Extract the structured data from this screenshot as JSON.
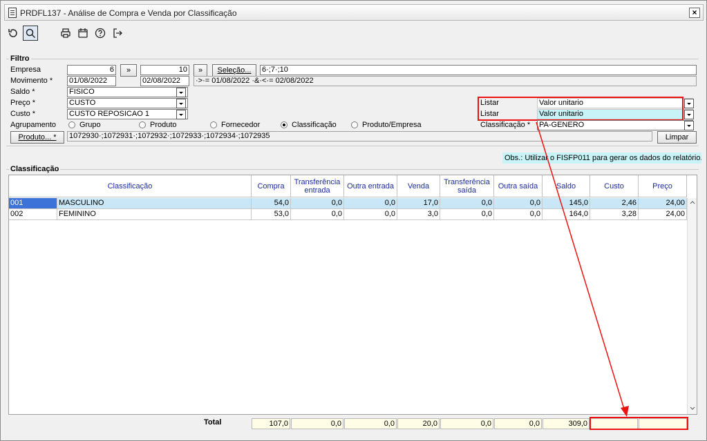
{
  "window": {
    "title": "PRDFL137 - Análise de Compra e Venda por Classificação",
    "close": "×"
  },
  "filtro": {
    "legend": "Filtro",
    "empresa_label": "Empresa",
    "empresa_from": "6",
    "empresa_to": "10",
    "range_btn": "»",
    "selecao_btn": "Seleção...",
    "selecao_value": "6·;7·;10",
    "movimento_label": "Movimento *",
    "movimento_from": "01/08/2022",
    "movimento_to": "02/08/2022",
    "movimento_expr": "·>·= 01/08/2022 ·&·<·= 02/08/2022",
    "saldo_label": "Saldo *",
    "saldo_value": "FISICO",
    "preco_label": "Preço *",
    "preco_value": "CUSTO",
    "custo_label": "Custo *",
    "custo_value": "CUSTO REPOSICAO 1",
    "agrupamento_label": "Agrupamento",
    "agrupamento_options": [
      "Grupo",
      "Produto",
      "Fornecedor",
      "Classificação",
      "Produto/Empresa"
    ],
    "agrupamento_selected": "Classificação",
    "produto_btn": "Produto... *",
    "produto_value": "1072930·;1072931·;1072932·;1072933·;1072934·;1072935",
    "listar1_label": "Listar",
    "listar1_value": "Valor unitario",
    "listar2_label": "Listar",
    "listar2_value": "Valor unitario",
    "classificacao_label": "Classificação *",
    "classificacao_value": "PA-GENERO",
    "limpar_btn": "Limpar"
  },
  "obs": "Obs.: Utilizar o FISFP011 para gerar os dados do relatório.",
  "grid": {
    "legend": "Classificação",
    "columns": [
      "Classificação",
      "Compra",
      "Transferência entrada",
      "Outra entrada",
      "Venda",
      "Transferência saída",
      "Outra saída",
      "Saldo",
      "Custo",
      "Preço"
    ],
    "rows": [
      {
        "code": "001",
        "name": "MASCULINO",
        "compra": "54,0",
        "transf_entrada": "0,0",
        "outra_entrada": "0,0",
        "venda": "17,0",
        "transf_saida": "0,0",
        "outra_saida": "0,0",
        "saldo": "145,0",
        "custo": "2,46",
        "preco": "24,00"
      },
      {
        "code": "002",
        "name": "FEMININO",
        "compra": "53,0",
        "transf_entrada": "0,0",
        "outra_entrada": "0,0",
        "venda": "3,0",
        "transf_saida": "0,0",
        "outra_saida": "0,0",
        "saldo": "164,0",
        "custo": "3,28",
        "preco": "24,00"
      }
    ],
    "total_label": "Total",
    "totals": {
      "compra": "107,0",
      "transf_entrada": "0,0",
      "outra_entrada": "0,0",
      "venda": "20,0",
      "transf_saida": "0,0",
      "outra_saida": "0,0",
      "saldo": "309,0",
      "custo": "",
      "preco": ""
    }
  },
  "colors": {
    "highlight": "#e11111",
    "selected_row": "#c9e7f7",
    "header_text": "#1a2aa0",
    "total_bg": "#fffde6"
  }
}
